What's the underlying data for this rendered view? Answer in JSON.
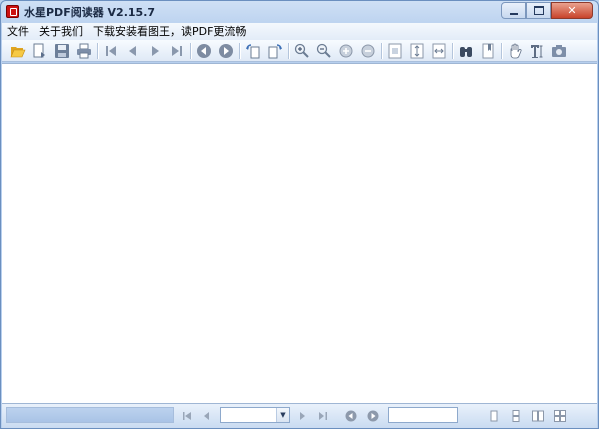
{
  "window": {
    "title": "水星PDF阅读器 V2.15.7"
  },
  "menu": {
    "items": [
      "文件",
      "关于我们",
      "下载安装看图王，读PDF更流畅"
    ]
  },
  "toolbar": {
    "buttons": [
      "open-folder-icon",
      "export-icon",
      "save-icon",
      "print-icon",
      "first-page-icon",
      "prev-page-icon",
      "next-page-icon",
      "last-page-icon",
      "back-icon",
      "forward-icon",
      "rotate-left-icon",
      "rotate-right-icon",
      "zoom-in-icon",
      "zoom-out-icon",
      "plus-circle-icon",
      "minus-circle-icon",
      "actual-size-icon",
      "fit-page-icon",
      "fit-width-icon",
      "find-icon",
      "bookmark-icon",
      "hand-tool-icon",
      "text-select-icon",
      "snapshot-icon"
    ]
  },
  "statusbar": {
    "status_text": "",
    "page_value": "",
    "zoom_value": ""
  },
  "colors": {
    "frame": "#bcd3ee",
    "document_bg": "#ffffff",
    "close_button": "#c8432b"
  }
}
